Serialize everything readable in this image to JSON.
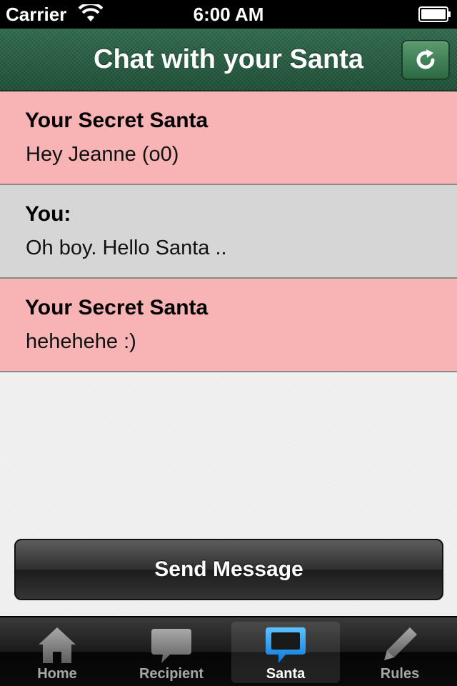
{
  "status_bar": {
    "carrier": "Carrier",
    "time": "6:00 AM"
  },
  "nav": {
    "title": "Chat with your Santa",
    "refresh_icon": "refresh-icon"
  },
  "messages": [
    {
      "sender": "Your Secret Santa",
      "text": "Hey Jeanne (o0)",
      "from": "santa"
    },
    {
      "sender": "You:",
      "text": "Oh boy. Hello Santa ..",
      "from": "me"
    },
    {
      "sender": "Your Secret Santa",
      "text": "hehehehe :)",
      "from": "santa"
    }
  ],
  "send_button": {
    "label": "Send Message"
  },
  "tabs": [
    {
      "label": "Home",
      "icon": "home-icon"
    },
    {
      "label": "Recipient",
      "icon": "speech-bubble-icon"
    },
    {
      "label": "Santa",
      "icon": "chat-bubble-icon",
      "selected": true
    },
    {
      "label": "Rules",
      "icon": "pencil-icon"
    }
  ],
  "colors": {
    "santa_message_bg": "#f8b3b4",
    "own_message_bg": "#d6d6d6",
    "nav_green": "#2f6a4c",
    "selected_tab_icon": "#1e8fe8"
  }
}
